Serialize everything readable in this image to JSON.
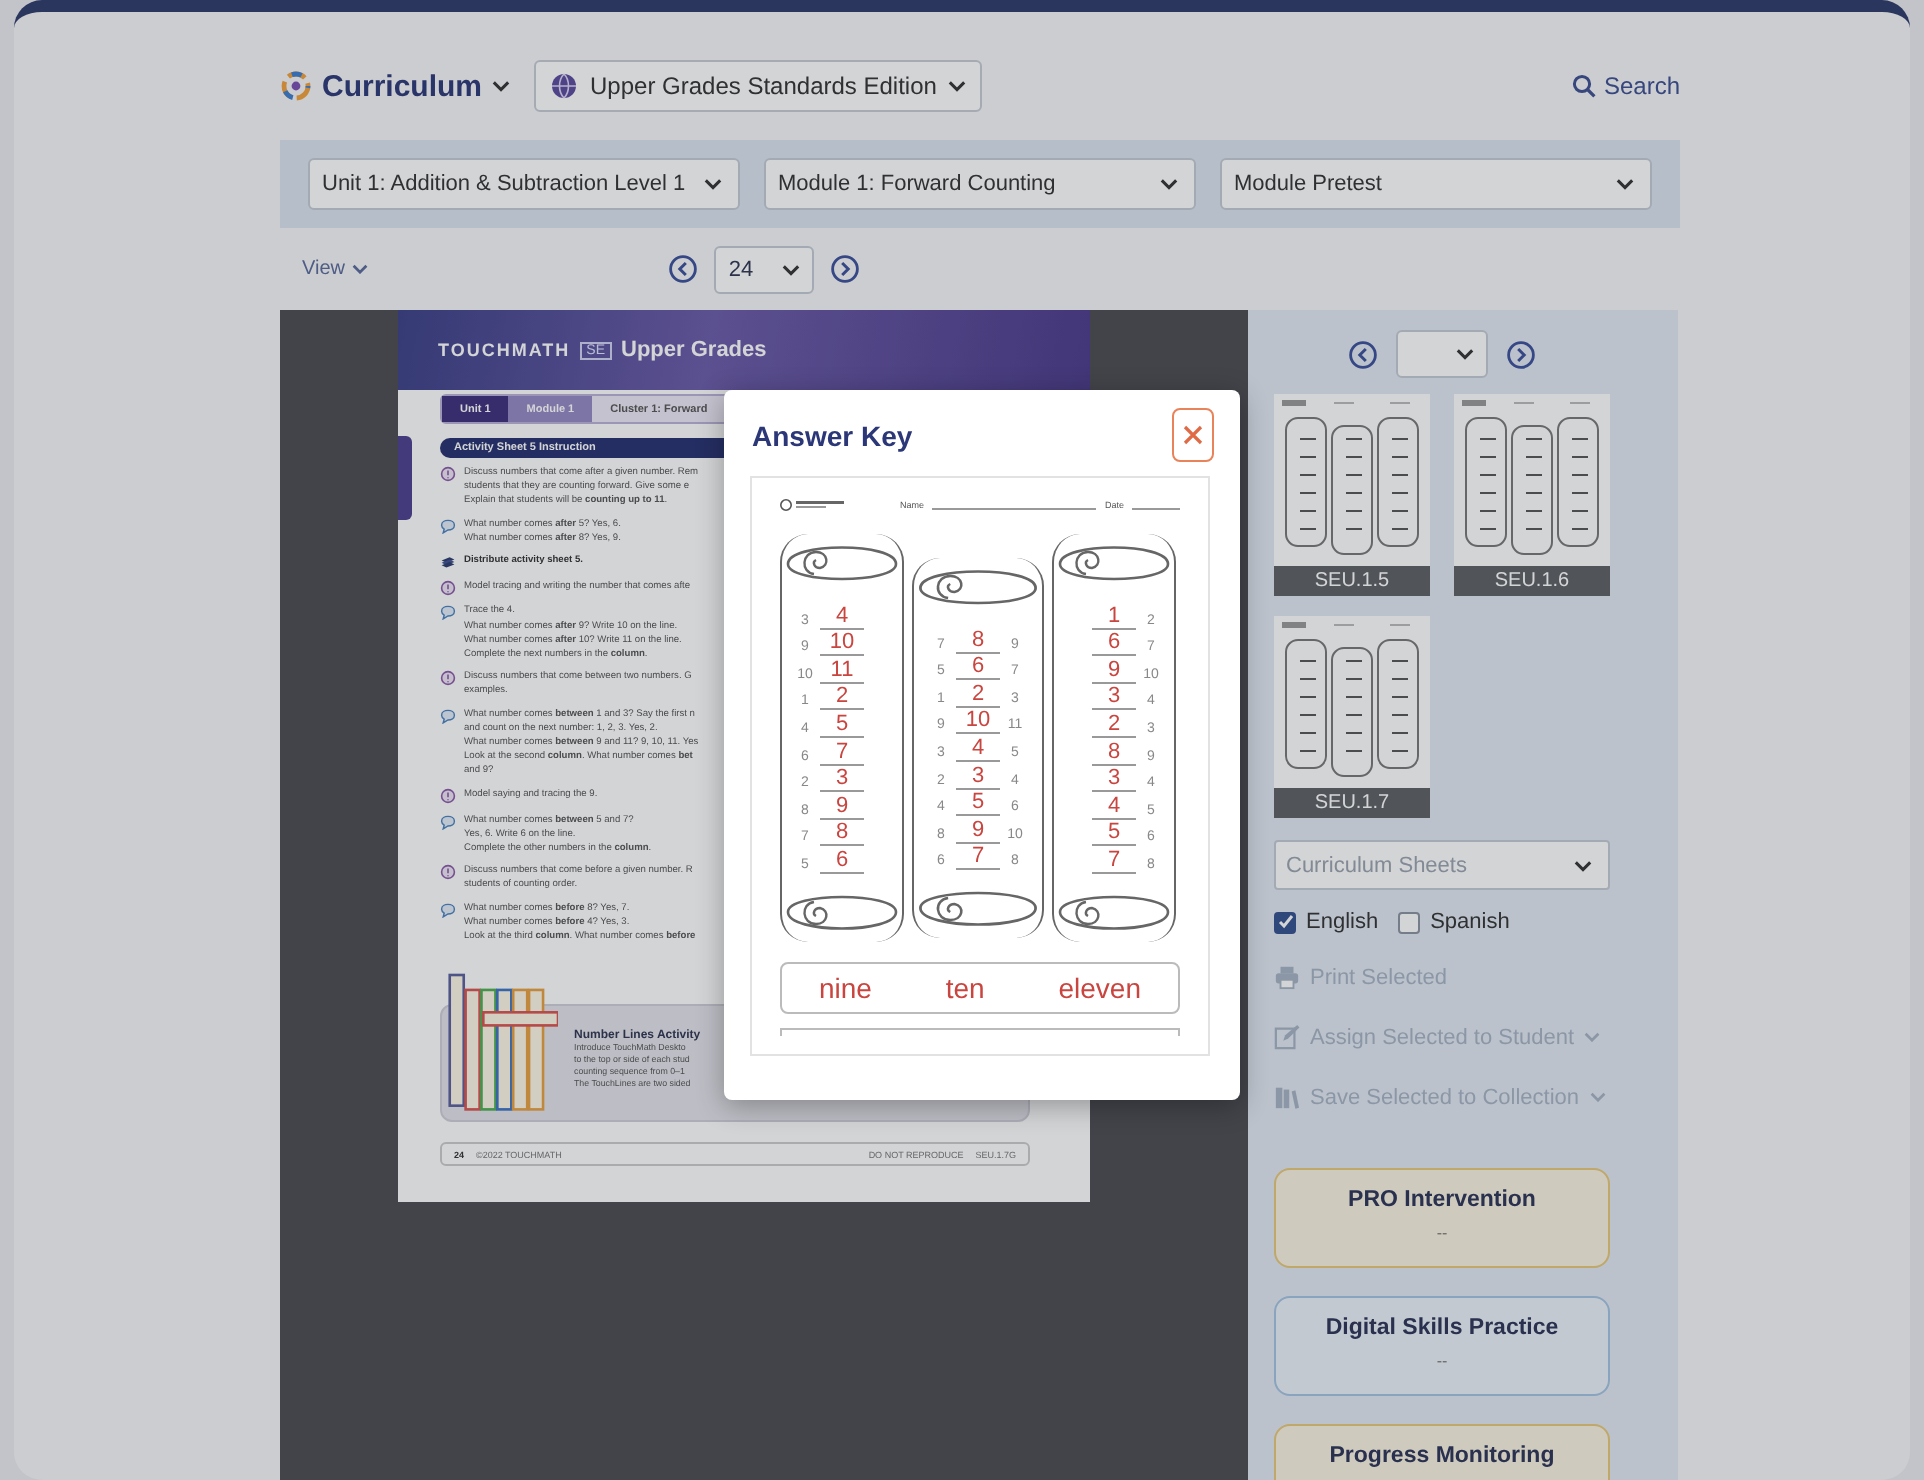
{
  "header": {
    "product": "Curriculum",
    "edition": "Upper Grades Standards Edition",
    "search": "Search"
  },
  "filters": [
    {
      "value": "Unit 1: Addition & Subtraction Level 1"
    },
    {
      "value": "Module 1: Forward Counting"
    },
    {
      "value": "Module Pretest"
    }
  ],
  "view": "View",
  "pager": {
    "page": "24"
  },
  "document": {
    "brand": "TOUCHMATH",
    "edition": "SE",
    "title": "Upper Grades",
    "breadcrumbs": [
      {
        "label": "Unit 1",
        "kind": "unit"
      },
      {
        "label": "Module 1",
        "kind": "module"
      },
      {
        "label": "Cluster 1: Forward",
        "kind": "cluster"
      }
    ],
    "section": "Activity Sheet 5 Instruction",
    "items": [
      {
        "kind": "teacher",
        "lines": [
          "Discuss numbers that come after a given number. Rem",
          "students that they are counting forward. Give some e",
          "Explain that students will be **counting up to 11**."
        ]
      },
      {
        "kind": "ask",
        "lines": [
          "What number comes **after** 5? Yes, 6.",
          "What number comes **after** 8? Yes, 9."
        ]
      },
      {
        "kind": "distribute",
        "lines": [
          "Distribute activity sheet 5."
        ]
      },
      {
        "kind": "teacher",
        "lines": [
          "Model tracing and writing the number that comes afte"
        ]
      },
      {
        "kind": "ask",
        "lines": [
          "Trace the 4.",
          "What number comes **after** 9? Write 10 on the line.",
          "What number comes **after** 10? Write 11 on the line.",
          "Complete the next numbers in the **column**."
        ]
      },
      {
        "kind": "teacher",
        "lines": [
          "Discuss numbers that come between two numbers. G",
          "examples."
        ]
      },
      {
        "kind": "ask",
        "lines": [
          "What number comes **between** 1 and 3? Say the first n",
          "and count on the next number: 1, 2, 3. Yes, 2.",
          "What number comes **between** 9 and 11? 9, 10, 11. Yes",
          "Look at the second **column**. What number comes **bet**",
          "and 9?"
        ]
      },
      {
        "kind": "teacher",
        "lines": [
          "Model saying and tracing the 9."
        ]
      },
      {
        "kind": "ask",
        "lines": [
          "What number comes **between** 5 and 7?",
          "Yes, 6. Write 6 on the line.",
          "Complete the other numbers in the **column**."
        ]
      },
      {
        "kind": "teacher",
        "lines": [
          "Discuss numbers that come before a given number. R",
          "students of counting order."
        ]
      },
      {
        "kind": "ask",
        "lines": [
          "What number comes **before** 8? Yes, 7.",
          "What number comes **before** 4? Yes, 3.",
          "Look at the third **column**. What number comes **before**"
        ]
      }
    ],
    "activity": {
      "title": "Number Lines Activity",
      "lines": [
        "Introduce TouchMath Deskto",
        "to the top or side of each stud",
        "counting sequence from 0–1",
        "The TouchLines are two sided"
      ]
    },
    "footer": {
      "page": "24",
      "copyright": "©2022 TOUCHMATH",
      "notice": "DO NOT REPRODUCE",
      "code": "SEU.1.7G"
    }
  },
  "sidebar": {
    "thumbnails": [
      {
        "label": "SEU.1.5"
      },
      {
        "label": "SEU.1.6"
      },
      {
        "label": "SEU.1.7"
      }
    ],
    "sheet_select": {
      "placeholder": "Curriculum Sheets"
    },
    "languages": [
      {
        "label": "English",
        "checked": true
      },
      {
        "label": "Spanish",
        "checked": false
      }
    ],
    "actions": [
      {
        "label": "Print Selected",
        "kind": "print",
        "disabled": true,
        "menu": false
      },
      {
        "label": "Assign Selected to Student",
        "kind": "assign",
        "disabled": true,
        "menu": true
      },
      {
        "label": "Save Selected to Collection",
        "kind": "save",
        "disabled": true,
        "menu": true
      }
    ],
    "cards": [
      {
        "title": "PRO Intervention",
        "value": "--",
        "color": "#bfa86a"
      },
      {
        "title": "Digital Skills Practice",
        "value": "--",
        "color": "#89a4be"
      },
      {
        "title": "Progress Monitoring",
        "color": "#bfa86a"
      }
    ]
  },
  "modal": {
    "title": "Answer Key",
    "worksheet": {
      "name_label": "Name",
      "date_label": "Date",
      "columns": [
        {
          "rows": [
            {
              "before": "3",
              "answer": "4"
            },
            {
              "before": "9",
              "answer": "10"
            },
            {
              "before": "10",
              "answer": "11"
            },
            {
              "before": "1",
              "answer": "2"
            },
            {
              "before": "4",
              "answer": "5"
            },
            {
              "before": "6",
              "answer": "7"
            },
            {
              "before": "2",
              "answer": "3"
            },
            {
              "before": "8",
              "answer": "9"
            },
            {
              "before": "7",
              "answer": "8"
            },
            {
              "before": "5",
              "answer": "6"
            }
          ]
        },
        {
          "rows": [
            {
              "before": "7",
              "answer": "8",
              "after": "9"
            },
            {
              "before": "5",
              "answer": "6",
              "after": "7"
            },
            {
              "before": "1",
              "answer": "2",
              "after": "3"
            },
            {
              "before": "9",
              "answer": "10",
              "after": "11"
            },
            {
              "before": "3",
              "answer": "4",
              "after": "5"
            },
            {
              "before": "2",
              "answer": "3",
              "after": "4"
            },
            {
              "before": "4",
              "answer": "5",
              "after": "6"
            },
            {
              "before": "8",
              "answer": "9",
              "after": "10"
            },
            {
              "before": "6",
              "answer": "7",
              "after": "8"
            }
          ]
        },
        {
          "rows": [
            {
              "answer": "1",
              "after": "2"
            },
            {
              "answer": "6",
              "after": "7"
            },
            {
              "answer": "9",
              "after": "10"
            },
            {
              "answer": "3",
              "after": "4"
            },
            {
              "answer": "2",
              "after": "3"
            },
            {
              "answer": "8",
              "after": "9"
            },
            {
              "answer": "3",
              "after": "4"
            },
            {
              "answer": "4",
              "after": "5"
            },
            {
              "answer": "5",
              "after": "6"
            },
            {
              "answer": "7",
              "after": "8"
            }
          ]
        }
      ],
      "words": [
        "nine",
        "ten",
        "eleven"
      ]
    }
  }
}
